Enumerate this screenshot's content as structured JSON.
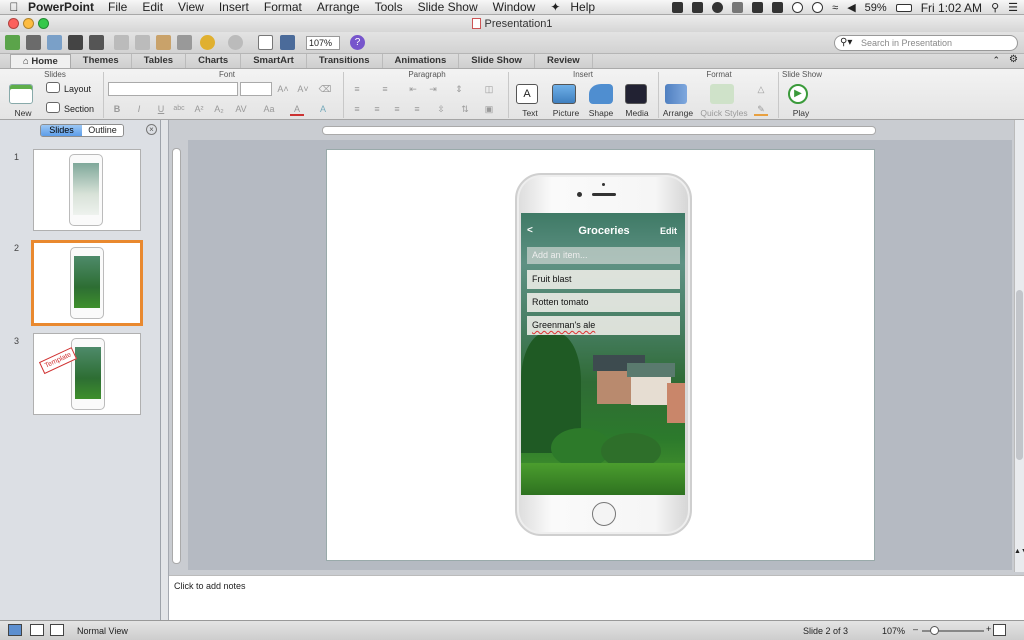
{
  "menubar": {
    "app_name": "PowerPoint",
    "items": [
      "File",
      "Edit",
      "View",
      "Insert",
      "Format",
      "Arrange",
      "Tools",
      "Slide Show",
      "Window",
      "Help"
    ],
    "battery": "59%",
    "clock": "Fri 1:02 AM"
  },
  "window": {
    "title": "Presentation1"
  },
  "toolbar": {
    "zoom": "107%",
    "search_placeholder": "Search in Presentation"
  },
  "ribbon": {
    "tabs": [
      "Home",
      "Themes",
      "Tables",
      "Charts",
      "SmartArt",
      "Transitions",
      "Animations",
      "Slide Show",
      "Review"
    ],
    "groups": {
      "slides": "Slides",
      "font": "Font",
      "paragraph": "Paragraph",
      "insert": "Insert",
      "format": "Format",
      "slideshow": "Slide Show"
    },
    "buttons": {
      "new_slide": "New Slide",
      "layout": "Layout",
      "section": "Section",
      "text": "Text",
      "picture": "Picture",
      "shape": "Shape",
      "media": "Media",
      "arrange": "Arrange",
      "quick_styles": "Quick Styles",
      "play": "Play"
    }
  },
  "leftpane": {
    "segments": [
      "Slides",
      "Outline"
    ],
    "thumbs": [
      {
        "num": "1"
      },
      {
        "num": "2"
      },
      {
        "num": "3",
        "stamp": "Template"
      }
    ]
  },
  "slide": {
    "app_header": {
      "back": "<",
      "title": "Groceries",
      "edit": "Edit"
    },
    "add_placeholder": "Add an item...",
    "items": [
      "Fruit blast",
      "Rotten tomato",
      "Greenman's ale"
    ]
  },
  "notes": {
    "placeholder": "Click to add notes"
  },
  "status": {
    "view": "Normal View",
    "slide": "Slide 2 of 3",
    "zoom": "107%"
  }
}
